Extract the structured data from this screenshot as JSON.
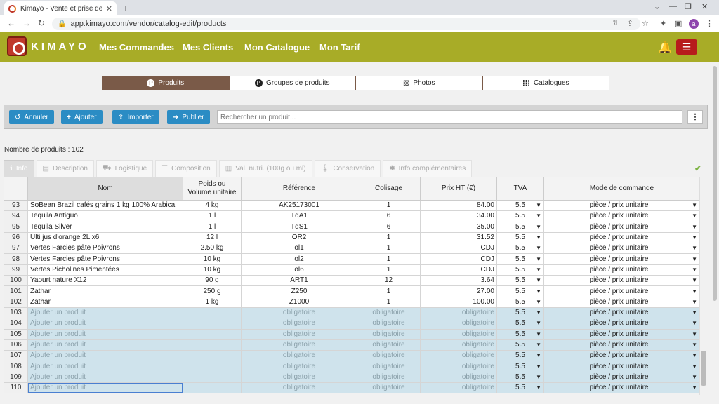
{
  "browser": {
    "tab_title": "Kimayo - Vente et prise de comm",
    "url": "app.kimayo.com/vendor/catalog-edit/products",
    "profile_initial": "a"
  },
  "header": {
    "logo_text": "KIMAYO",
    "nav": [
      "Mes Commandes",
      "Mes Clients",
      "Mon Catalogue",
      "Mon Tarif"
    ]
  },
  "segments": [
    {
      "label": "Produits",
      "icon": "P"
    },
    {
      "label": "Groupes de produits",
      "icon": "P"
    },
    {
      "label": "Photos",
      "icon": "image-icon"
    },
    {
      "label": "Catalogues",
      "icon": "grid-icon"
    }
  ],
  "toolbar": {
    "cancel": "Annuler",
    "add": "Ajouter",
    "import": "Importer",
    "publish": "Publier",
    "search_placeholder": "Rechercher un produit..."
  },
  "count_label": "Nombre de produits : 102",
  "section_tabs": [
    "Info",
    "Description",
    "Logistique",
    "Composition",
    "Val. nutri. (100g ou ml)",
    "Conservation",
    "Info complémentaires"
  ],
  "columns": {
    "name": "Nom",
    "weight_1": "Poids ou",
    "weight_2": "Volume unitaire",
    "ref": "Référence",
    "pack": "Colisage",
    "price": "Prix HT (€)",
    "tva": "TVA",
    "mode": "Mode de commande"
  },
  "rows": [
    {
      "n": "93",
      "name": "SoBean Brazil cafés grains 1 kg 100% Arabica",
      "weight": "4 kg",
      "ref": "AK25173001",
      "pack": "1",
      "price": "84.00",
      "tva": "5.5",
      "mode": "pièce / prix unitaire"
    },
    {
      "n": "94",
      "name": "Tequila Antiguo",
      "weight": "1 l",
      "ref": "TqA1",
      "pack": "6",
      "price": "34.00",
      "tva": "5.5",
      "mode": "pièce / prix unitaire"
    },
    {
      "n": "95",
      "name": "Tequila Silver",
      "weight": "1 l",
      "ref": "TqS1",
      "pack": "6",
      "price": "35.00",
      "tva": "5.5",
      "mode": "pièce / prix unitaire"
    },
    {
      "n": "96",
      "name": "Ulti jus d'orange 2L x6",
      "weight": "12 l",
      "ref": "OR2",
      "pack": "1",
      "price": "31.52",
      "tva": "5.5",
      "mode": "pièce / prix unitaire"
    },
    {
      "n": "97",
      "name": "Vertes Farcies pâte Poivrons",
      "weight": "2.50 kg",
      "ref": "ol1",
      "pack": "1",
      "price": "CDJ",
      "tva": "5.5",
      "mode": "pièce / prix unitaire"
    },
    {
      "n": "98",
      "name": "Vertes Farcies pâte Poivrons",
      "weight": "10 kg",
      "ref": "ol2",
      "pack": "1",
      "price": "CDJ",
      "tva": "5.5",
      "mode": "pièce / prix unitaire"
    },
    {
      "n": "99",
      "name": "Vertes Picholines Pimentées",
      "weight": "10 kg",
      "ref": "ol6",
      "pack": "1",
      "price": "CDJ",
      "tva": "5.5",
      "mode": "pièce / prix unitaire"
    },
    {
      "n": "100",
      "name": "Yaourt nature X12",
      "weight": "90 g",
      "ref": "ART1",
      "pack": "12",
      "price": "3.64",
      "tva": "5.5",
      "mode": "pièce / prix unitaire"
    },
    {
      "n": "101",
      "name": "Zathar",
      "weight": "250 g",
      "ref": "Z250",
      "pack": "1",
      "price": "27.00",
      "tva": "5.5",
      "mode": "pièce / prix unitaire"
    },
    {
      "n": "102",
      "name": "Zathar",
      "weight": "1 kg",
      "ref": "Z1000",
      "pack": "1",
      "price": "100.00",
      "tva": "5.5",
      "mode": "pièce / prix unitaire"
    }
  ],
  "empty_rows": {
    "numbers": [
      "103",
      "104",
      "105",
      "106",
      "107",
      "108",
      "109",
      "110"
    ],
    "name_placeholder": "Ajouter un produit",
    "required": "obligatoire",
    "tva": "5.5",
    "mode": "pièce / prix unitaire"
  },
  "colors": {
    "header": "#a8ac27",
    "active_segment": "#7a5a48",
    "button": "#2b8cc4",
    "empty_row": "#cfe3ec"
  }
}
